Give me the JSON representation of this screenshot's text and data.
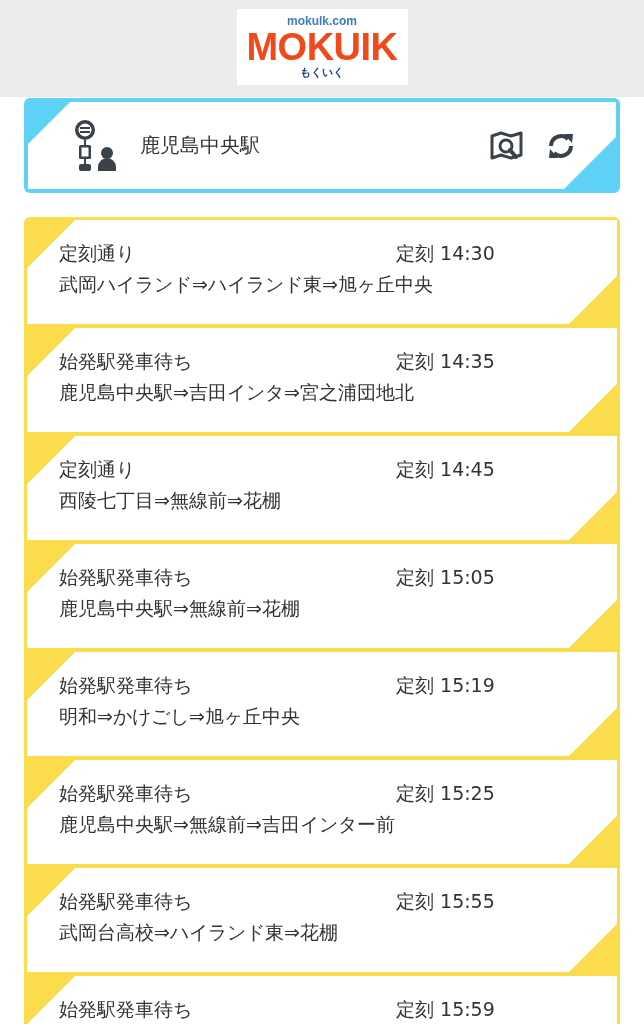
{
  "header": {
    "logo": {
      "domain": "mokulk.com",
      "name": "MOKUIK",
      "kana": "もくいく"
    }
  },
  "stop": {
    "name": "鹿児島中央駅"
  },
  "departures": [
    {
      "status": "定刻通り",
      "time": "定刻 14:30",
      "route": "武岡ハイランド⇒ハイランド東⇒旭ヶ丘中央"
    },
    {
      "status": "始発駅発車待ち",
      "time": "定刻 14:35",
      "route": "鹿児島中央駅⇒吉田インタ⇒宮之浦団地北"
    },
    {
      "status": "定刻通り",
      "time": "定刻 14:45",
      "route": "西陵七丁目⇒無線前⇒花棚"
    },
    {
      "status": "始発駅発車待ち",
      "time": "定刻 15:05",
      "route": "鹿児島中央駅⇒無線前⇒花棚"
    },
    {
      "status": "始発駅発車待ち",
      "time": "定刻 15:19",
      "route": "明和⇒かけごし⇒旭ヶ丘中央"
    },
    {
      "status": "始発駅発車待ち",
      "time": "定刻 15:25",
      "route": "鹿児島中央駅⇒無線前⇒吉田インター前"
    },
    {
      "status": "始発駅発車待ち",
      "time": "定刻 15:55",
      "route": "武岡台高校⇒ハイランド東⇒花棚"
    },
    {
      "status": "始発駅発車待ち",
      "time": "定刻 15:59"
    }
  ]
}
